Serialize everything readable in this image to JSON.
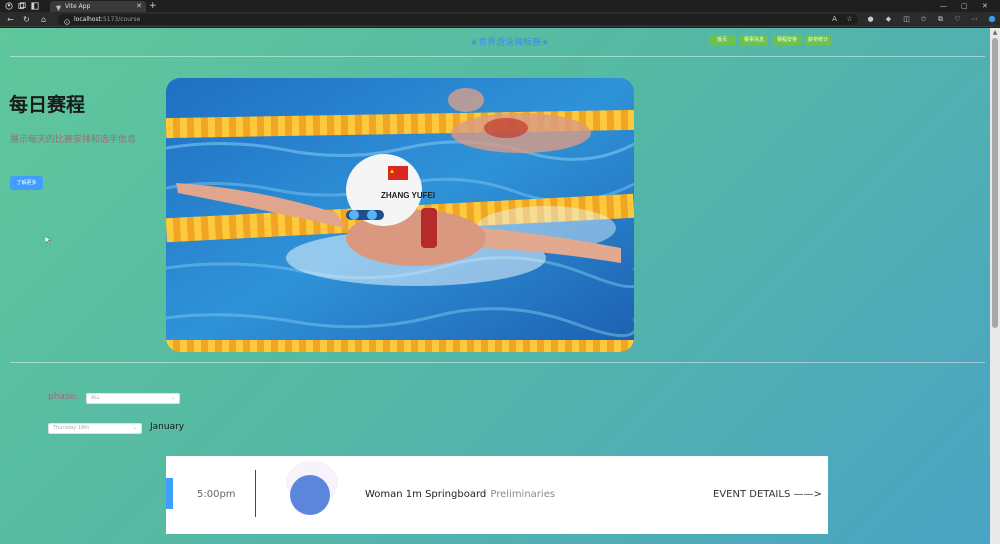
{
  "browser": {
    "tab_title": "Vite App",
    "url_host": "localhost:",
    "url_path": "5173/course",
    "new_tab_label": "+",
    "window_controls": [
      "—",
      "▢",
      "✕"
    ]
  },
  "site": {
    "title": "★世界游泳锦标赛★",
    "nav": [
      "首页",
      "赛事信息",
      "赛程安排",
      "获奖统计"
    ]
  },
  "hero": {
    "title": "每日赛程",
    "subtitle": "展示每天的比赛安排和选手信息",
    "button": "了解更多",
    "image_caption": "ZHANG YUFEI"
  },
  "filters": {
    "phase_label": "phase:",
    "phase_value": "ALL",
    "date_value": "Thursday 18th",
    "month": "January"
  },
  "schedule": [
    {
      "time": "5:00pm",
      "event": "Woman 1m Springboard",
      "phase": "· Preliminaries",
      "details": "EVENT DETAILS ——>"
    }
  ],
  "colors": {
    "accent_blue": "#409eff",
    "nav_green": "#6cc24a",
    "title_blue": "#3f8ee6",
    "subtitle_mauve": "#9b6b78",
    "avatar_blue": "#5b86db"
  }
}
